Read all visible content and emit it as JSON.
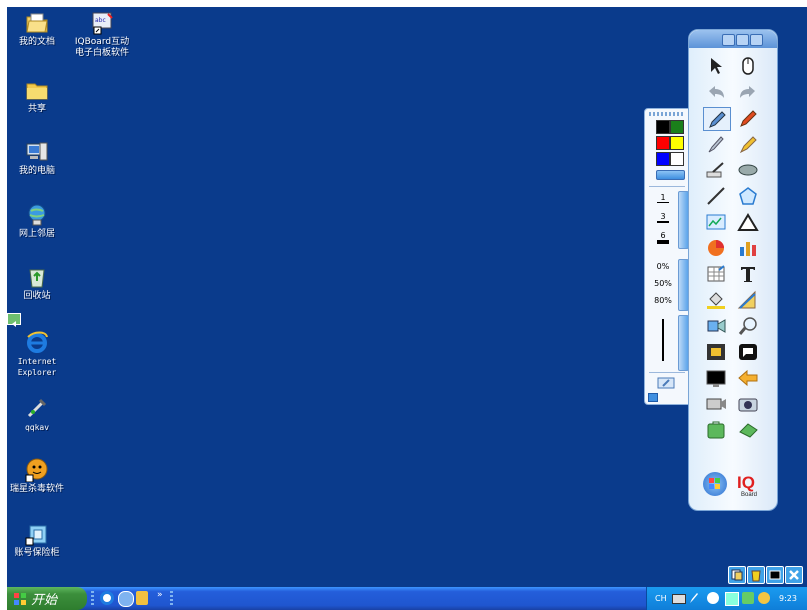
{
  "desktop": {
    "icons": [
      {
        "label": "我的文档",
        "icon": "my-documents-icon"
      },
      {
        "label": "IQBoard互动\n电子白板软件",
        "icon": "iqboard-shortcut-icon"
      },
      {
        "label": "共享",
        "icon": "folder-icon"
      },
      {
        "label": "我的电脑",
        "icon": "my-computer-icon"
      },
      {
        "label": "网上邻居",
        "icon": "network-icon"
      },
      {
        "label": "回收站",
        "icon": "recycle-bin-icon"
      },
      {
        "label": "Internet\nExplorer",
        "icon": "ie-icon"
      },
      {
        "label": "qqkav",
        "icon": "qqkav-icon"
      },
      {
        "label": "瑞星杀毒软件",
        "icon": "rising-antivirus-icon"
      },
      {
        "label": "账号保险柜",
        "icon": "account-safe-icon"
      }
    ]
  },
  "palette": {
    "colors": [
      "#000000",
      "#1a7f1a",
      "#ff0000",
      "#ffff00",
      "#0000ff",
      "#ffffff"
    ],
    "sizes": [
      "1",
      "3",
      "6"
    ],
    "opacity": [
      "0%",
      "50%",
      "80%"
    ]
  },
  "taskbar": {
    "start_label": "开始",
    "tray_lang": "CH",
    "clock": "9:23"
  }
}
